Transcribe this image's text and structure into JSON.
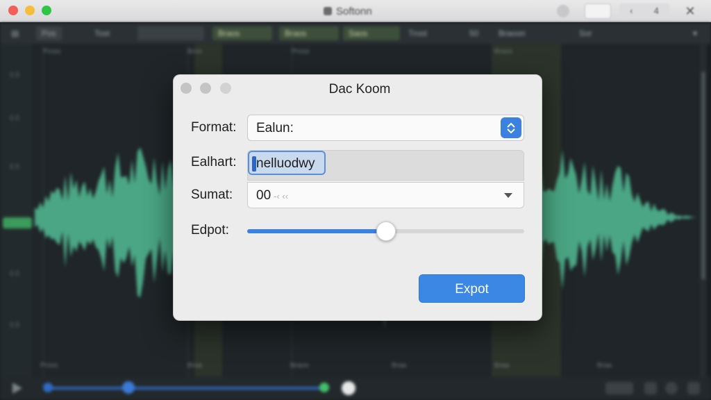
{
  "window": {
    "title": "Softonn",
    "pill_label": "",
    "nav_prev": "‹",
    "nav_next": "4"
  },
  "editor": {
    "tools": [
      "Pos",
      "Tost",
      "",
      "Braos",
      "Braos",
      "Saos",
      "Trost",
      "50",
      "Braoon",
      "Sor"
    ],
    "ruler_marks": [
      "Pross",
      "Broo",
      "Pross",
      "Braos"
    ],
    "bottom_marks": [
      "Pross",
      "Braa",
      "Braoo",
      "Braa",
      "Braa",
      "Braa"
    ],
    "lane_labels": [
      "0.5",
      "0.5",
      "0.5",
      "0.5",
      "0.5",
      "0.5"
    ]
  },
  "dialog": {
    "title": "Dac Koom",
    "format_label": "Format:",
    "format_value": "Ealun:",
    "name_label": "Ealhart:",
    "name_value": "nelluodwy",
    "sumat_label": "Sumat:",
    "sumat_value": "00",
    "sumat_suffix": "-‹ ‹‹",
    "export_label": "Edpot:",
    "export_slider": 0.5,
    "export_button": "Expot"
  },
  "colors": {
    "accent": "#3b87e4",
    "waveform": "#4fb58f"
  }
}
